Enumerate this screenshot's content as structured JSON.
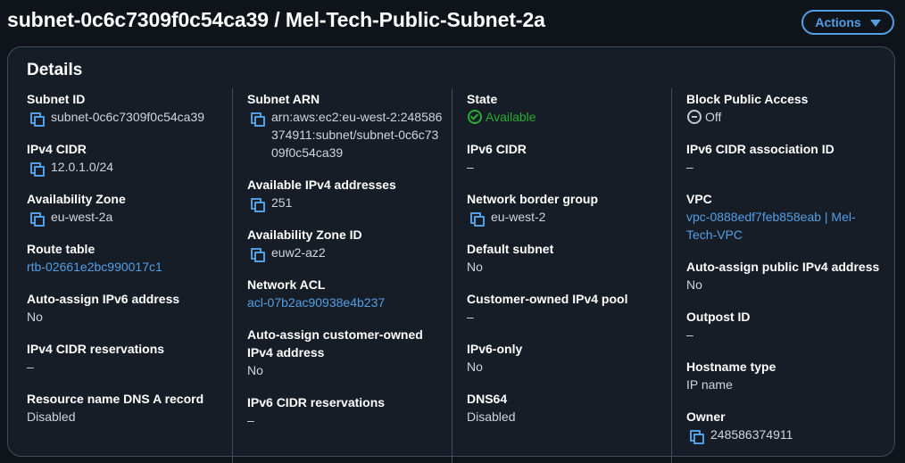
{
  "header": {
    "title": "subnet-0c6c7309f0c54ca39 / Mel-Tech-Public-Subnet-2a",
    "actions_label": "Actions"
  },
  "details": {
    "title": "Details",
    "col1": [
      {
        "label": "Subnet ID",
        "value": "subnet-0c6c7309f0c54ca39"
      },
      {
        "label": "IPv4 CIDR",
        "value": "12.0.1.0/24"
      },
      {
        "label": "Availability Zone",
        "value": "eu-west-2a"
      },
      {
        "label": "Route table",
        "value": "rtb-02661e2bc990017c1"
      },
      {
        "label": "Auto-assign IPv6 address",
        "value": "No"
      },
      {
        "label": "IPv4 CIDR reservations",
        "value": "–"
      },
      {
        "label": "Resource name DNS A record",
        "value": "Disabled"
      }
    ],
    "col2": [
      {
        "label": "Subnet ARN",
        "value": "arn:aws:ec2:eu-west-2:248586374911:subnet/subnet-0c6c7309f0c54ca39"
      },
      {
        "label": "Available IPv4 addresses",
        "value": "251"
      },
      {
        "label": "Availability Zone ID",
        "value": "euw2-az2"
      },
      {
        "label": "Network ACL",
        "value": "acl-07b2ac90938e4b237"
      },
      {
        "label": "Auto-assign customer-owned IPv4 address",
        "value": "No"
      },
      {
        "label": "IPv6 CIDR reservations",
        "value": "–"
      }
    ],
    "col3": [
      {
        "label": "State",
        "value": "Available"
      },
      {
        "label": "IPv6 CIDR",
        "value": "–"
      },
      {
        "label": "Network border group",
        "value": "eu-west-2"
      },
      {
        "label": "Default subnet",
        "value": "No"
      },
      {
        "label": "Customer-owned IPv4 pool",
        "value": "–"
      },
      {
        "label": "IPv6-only",
        "value": "No"
      },
      {
        "label": "DNS64",
        "value": "Disabled"
      }
    ],
    "col4": [
      {
        "label": "Block Public Access",
        "value": "Off"
      },
      {
        "label": "IPv6 CIDR association ID",
        "value": "–"
      },
      {
        "label": "VPC",
        "value": "vpc-0888edf7feb858eab | Mel-Tech-VPC"
      },
      {
        "label": "Auto-assign public IPv4 address",
        "value": "No"
      },
      {
        "label": "Outpost ID",
        "value": "–"
      },
      {
        "label": "Hostname type",
        "value": "IP name"
      },
      {
        "label": "Owner",
        "value": "248586374911"
      }
    ]
  },
  "colors": {
    "background": "#0f141a",
    "panel": "#161d26",
    "link": "#539fe5",
    "success": "#29ad32",
    "border": "#414d5c"
  },
  "icons": {
    "copy": "copy-icon",
    "status_available": "status-positive-icon",
    "status_off": "status-stopped-icon",
    "dropdown": "caret-down-icon"
  }
}
